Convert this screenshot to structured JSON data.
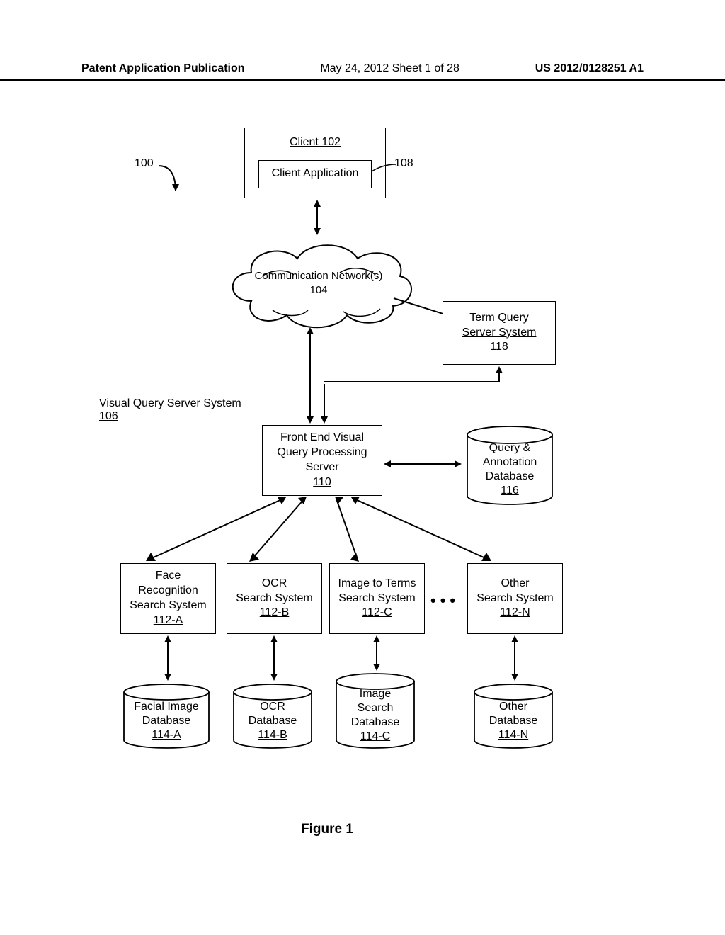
{
  "header": {
    "left": "Patent Application Publication",
    "mid": "May 24, 2012  Sheet 1 of 28",
    "right": "US 2012/0128251 A1"
  },
  "labels": {
    "system_ref": "100",
    "client_app_ref": "108"
  },
  "client": {
    "title": "Client 102",
    "app": "Client Application"
  },
  "cloud": {
    "line1": "Communication Network(s)",
    "line2": "104"
  },
  "term_query": {
    "line1": "Term Query",
    "line2": "Server System",
    "ref": "118"
  },
  "vq": {
    "title": "Visual Query Server System",
    "ref": "106"
  },
  "frontend": {
    "line1": "Front End Visual",
    "line2": "Query Processing",
    "line3": "Server",
    "ref": "110"
  },
  "qadb": {
    "line1": "Query &",
    "line2": "Annotation",
    "line3": "Database",
    "ref": "116"
  },
  "search_systems": {
    "face": {
      "l1": "Face",
      "l2": "Recognition",
      "l3": "Search System",
      "ref": "112-A"
    },
    "ocr": {
      "l1": "OCR",
      "l2": "Search System",
      "ref": "112-B"
    },
    "img": {
      "l1": "Image to Terms",
      "l2": "Search System",
      "ref": "112-C"
    },
    "other": {
      "l1": "Other",
      "l2": "Search System",
      "ref": "112-N"
    }
  },
  "databases": {
    "face": {
      "l1": "Facial Image",
      "l2": "Database",
      "ref": "114-A"
    },
    "ocr": {
      "l1": "OCR",
      "l2": "Database",
      "ref": "114-B"
    },
    "img": {
      "l1": "Image",
      "l2": "Search",
      "l3": "Database",
      "ref": "114-C"
    },
    "other": {
      "l1": "Other",
      "l2": "Database",
      "ref": "114-N"
    }
  },
  "figure_caption": "Figure 1"
}
